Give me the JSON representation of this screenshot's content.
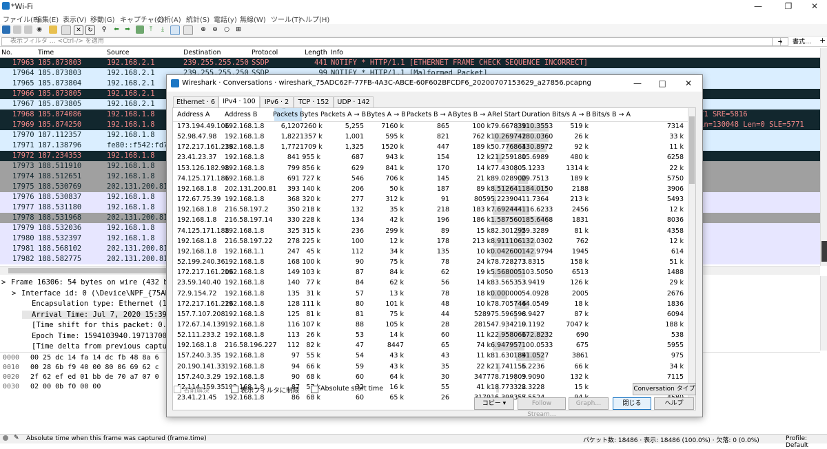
{
  "window": {
    "title": "*Wi-Fi"
  },
  "menu": [
    "ファイル(F)",
    "編集(E)",
    "表示(V)",
    "移動(G)",
    "キャプチャ(C)",
    "分析(A)",
    "統計(S)",
    "電話(y)",
    "無線(W)",
    "ツール(T)",
    "ヘルプ(H)"
  ],
  "filter": {
    "placeholder": "表示フィルタ … <Ctrl-/> を適用",
    "expr_label": "書式…",
    "add": "+"
  },
  "packet_list": {
    "columns": [
      "No.",
      "Time",
      "Source",
      "Destination",
      "Protocol",
      "Length",
      "Info"
    ],
    "rows": [
      {
        "no": "17963",
        "time": "185.873803",
        "src": "192.168.2.1",
        "dst": "239.255.255.250",
        "proto": "SSDP",
        "len": "441",
        "info": "NOTIFY * HTTP/1.1  [ETHERNET FRAME CHECK SEQUENCE INCORRECT]",
        "style": "dark"
      },
      {
        "no": "17964",
        "time": "185.873803",
        "src": "192.168.2.1",
        "dst": "239.255.255.250",
        "proto": "SSDP",
        "len": "99",
        "info": "NOTIFY * HTTP/1.1 [Malformed Packet]",
        "style": "light"
      },
      {
        "no": "17965",
        "time": "185.873804",
        "src": "192.168.2.1",
        "dst": "",
        "proto": "",
        "len": "",
        "info": "",
        "style": "light"
      },
      {
        "no": "17966",
        "time": "185.873805",
        "src": "192.168.2.1",
        "dst": "",
        "proto": "",
        "len": "",
        "info": "",
        "style": "dark"
      },
      {
        "no": "17967",
        "time": "185.873805",
        "src": "192.168.2.1",
        "dst": "",
        "proto": "",
        "len": "",
        "info": "",
        "style": "light"
      },
      {
        "no": "17968",
        "time": "185.874086",
        "src": "192.168.1.8",
        "dst": "",
        "proto": "",
        "len": "",
        "info": "71 SRE=5816",
        "style": "dark"
      },
      {
        "no": "17969",
        "time": "185.874250",
        "src": "192.168.1.8",
        "dst": "",
        "proto": "",
        "len": "",
        "info": "in=130048 Len=0 SLE=5771",
        "style": "dark"
      },
      {
        "no": "17970",
        "time": "187.112357",
        "src": "192.168.1.8",
        "dst": "",
        "proto": "",
        "len": "",
        "info": "",
        "style": "light"
      },
      {
        "no": "17971",
        "time": "187.138796",
        "src": "fe80::f542:fd7",
        "dst": "",
        "proto": "",
        "len": "",
        "info": "",
        "style": "light"
      },
      {
        "no": "17972",
        "time": "187.234353",
        "src": "192.168.1.8",
        "dst": "",
        "proto": "",
        "len": "",
        "info": "",
        "style": "dark"
      },
      {
        "no": "17973",
        "time": "188.511910",
        "src": "192.168.1.8",
        "dst": "",
        "proto": "",
        "len": "",
        "info": "",
        "style": "gray"
      },
      {
        "no": "17974",
        "time": "188.512651",
        "src": "192.168.1.8",
        "dst": "",
        "proto": "",
        "len": "",
        "info": "",
        "style": "gray"
      },
      {
        "no": "17975",
        "time": "188.530769",
        "src": "202.131.200.81",
        "dst": "",
        "proto": "",
        "len": "",
        "info": "",
        "style": "gray"
      },
      {
        "no": "17976",
        "time": "188.530837",
        "src": "192.168.1.8",
        "dst": "",
        "proto": "",
        "len": "",
        "info": "",
        "style": "lavender"
      },
      {
        "no": "17977",
        "time": "188.531180",
        "src": "192.168.1.8",
        "dst": "",
        "proto": "",
        "len": "",
        "info": "",
        "style": "lavender"
      },
      {
        "no": "17978",
        "time": "188.531968",
        "src": "202.131.200.81",
        "dst": "",
        "proto": "",
        "len": "",
        "info": "",
        "style": "gray"
      },
      {
        "no": "17979",
        "time": "188.532036",
        "src": "192.168.1.8",
        "dst": "",
        "proto": "",
        "len": "",
        "info": "",
        "style": "lavender"
      },
      {
        "no": "17980",
        "time": "188.532397",
        "src": "192.168.1.8",
        "dst": "",
        "proto": "",
        "len": "",
        "info": "",
        "style": "lavender"
      },
      {
        "no": "17981",
        "time": "188.568102",
        "src": "202.131.200.81",
        "dst": "",
        "proto": "",
        "len": "",
        "info": "",
        "style": "lavender"
      },
      {
        "no": "17982",
        "time": "188.582775",
        "src": "202.131.200.81",
        "dst": "",
        "proto": "",
        "len": "",
        "info": "",
        "style": "lavender"
      }
    ]
  },
  "details": [
    {
      "text": "Frame 16306: 54 bytes on wire (432 b",
      "indent": 0,
      "arrow": ">"
    },
    {
      "text": "Interface id: 0 (\\Device\\NPF_{75AD",
      "indent": 1,
      "arrow": ">"
    },
    {
      "text": "Encapsulation type: Ethernet (1)",
      "indent": 2,
      "arrow": ""
    },
    {
      "text": "Arrival Time: Jul  7, 2020 15:39:0",
      "indent": 2,
      "arrow": "",
      "selected": true
    },
    {
      "text": "[Time shift for this packet: 0.000",
      "indent": 2,
      "arrow": ""
    },
    {
      "text": "Epoch Time: 1594103940.197137000 s",
      "indent": 2,
      "arrow": ""
    },
    {
      "text": "[Time delta from previous captured",
      "indent": 2,
      "arrow": ""
    }
  ],
  "hex": [
    {
      "offset": "0000",
      "bytes": "00 25 dc 14 fa 14 dc fb  48 8a 6"
    },
    {
      "offset": "0010",
      "bytes": "00 28 6b f9 40 00 80 06  69 62 c"
    },
    {
      "offset": "0020",
      "bytes": "2f 62 ef ed 01 bb de 70  a7 07 0"
    },
    {
      "offset": "0030",
      "bytes": "02 00 0b f0 00 00"
    }
  ],
  "status": {
    "text": "Absolute time when this frame was captured (frame.time)",
    "packets": "パケット数: 18486 · 表示: 18486 (100.0%) · 欠落: 0 (0.0%)",
    "profile": "Profile: Default"
  },
  "dialog": {
    "title": "Wireshark · Conversations · wireshark_75ADC62F-77FB-4A3C-ABCE-60F602BFCDF6_20200707153629_a27856.pcapng",
    "tabs": [
      "Ethernet · 6",
      "IPv4 · 100",
      "IPv6 · 2",
      "TCP · 152",
      "UDP · 142"
    ],
    "active_tab": 1,
    "columns": [
      "Address A",
      "Address B",
      "Packets",
      "Bytes",
      "Packets A → B",
      "Bytes A → B",
      "Packets B → A",
      "Bytes B → A",
      "Rel Start",
      "Duration",
      "Bits/s A → B",
      "Bits/s B → A"
    ],
    "rows": [
      {
        "a": "173.194.49.106",
        "b": "192.168.1.8",
        "pk": "6,120",
        "by": "7260 k",
        "pab": "5,255",
        "bab": "7160 k",
        "pba": "865",
        "bba": "100 k",
        "rs": "79.667839",
        "du": "110.3553",
        "bsab": "519 k",
        "bsba": "7314",
        "rsf": 0.43,
        "duf": 0.6
      },
      {
        "a": "52.98.47.98",
        "b": "192.168.1.8",
        "pk": "1,822",
        "by": "1357 k",
        "pab": "1,001",
        "bab": "595 k",
        "pba": "821",
        "bba": "762 k",
        "rs": "10.269742",
        "du": "180.0360",
        "bsab": "26 k",
        "bsba": "33 k",
        "rsf": 0.06,
        "duf": 0.97
      },
      {
        "a": "172.217.161.238",
        "b": "192.168.1.8",
        "pk": "1,772",
        "by": "1709 k",
        "pab": "1,325",
        "bab": "1520 k",
        "pba": "447",
        "bba": "189 k",
        "rs": "50.776864",
        "du": "130.8972",
        "bsab": "92 k",
        "bsba": "11 k",
        "rsf": 0.27,
        "duf": 0.7
      },
      {
        "a": "23.41.23.37",
        "b": "192.168.1.8",
        "pk": "841",
        "by": "955 k",
        "pab": "687",
        "bab": "943 k",
        "pba": "154",
        "bba": "12 k",
        "rs": "21.259180",
        "du": "15.6989",
        "bsab": "480 k",
        "bsba": "6258",
        "rsf": 0.11,
        "duf": 0.09
      },
      {
        "a": "153.126.182.98",
        "b": "192.168.1.8",
        "pk": "799",
        "by": "856 k",
        "pab": "629",
        "bab": "841 k",
        "pba": "170",
        "bba": "14 k",
        "rs": "77.430805",
        "du": "5.1233",
        "bsab": "1314 k",
        "bsba": "22 k",
        "rsf": 0.42,
        "duf": 0.03
      },
      {
        "a": "74.125.171.186",
        "b": "192.168.1.8",
        "pk": "691",
        "by": "727 k",
        "pab": "546",
        "bab": "706 k",
        "pba": "145",
        "bba": "21 k",
        "rs": "89.028900",
        "du": "29.7513",
        "bsab": "189 k",
        "bsba": "5750",
        "rsf": 0.48,
        "duf": 0.16
      },
      {
        "a": "192.168.1.8",
        "b": "202.131.200.81",
        "pk": "393",
        "by": "140 k",
        "pab": "206",
        "bab": "50 k",
        "pba": "187",
        "bba": "89 k",
        "rs": "8.512641",
        "du": "184.0150",
        "bsab": "2188",
        "bsba": "3906",
        "rsf": 0.05,
        "duf": 0.99
      },
      {
        "a": "172.67.75.39",
        "b": "192.168.1.8",
        "pk": "368",
        "by": "320 k",
        "pab": "277",
        "bab": "312 k",
        "pba": "91",
        "bba": "8059",
        "rs": "5.223904",
        "du": "11.7364",
        "bsab": "213 k",
        "bsba": "5493",
        "rsf": 0.03,
        "duf": 0.06
      },
      {
        "a": "192.168.1.8",
        "b": "216.58.197.2",
        "pk": "350",
        "by": "218 k",
        "pab": "132",
        "bab": "35 k",
        "pba": "218",
        "bba": "183 k",
        "rs": "7.692444",
        "du": "116.6233",
        "bsab": "2456",
        "bsba": "12 k",
        "rsf": 0.04,
        "duf": 0.63
      },
      {
        "a": "192.168.1.8",
        "b": "216.58.197.14",
        "pk": "330",
        "by": "228 k",
        "pab": "134",
        "bab": "42 k",
        "pba": "196",
        "bba": "186 k",
        "rs": "1.587560",
        "du": "185.6468",
        "bsab": "1831",
        "bsba": "8036",
        "rsf": 0.01,
        "duf": 1.0
      },
      {
        "a": "74.125.171.188",
        "b": "192.168.1.8",
        "pk": "325",
        "by": "315 k",
        "pab": "236",
        "bab": "299 k",
        "pba": "89",
        "bba": "15 k",
        "rs": "82.301295",
        "du": "29.3289",
        "bsab": "81 k",
        "bsba": "4358",
        "rsf": 0.44,
        "duf": 0.16
      },
      {
        "a": "192.168.1.8",
        "b": "216.58.197.22",
        "pk": "278",
        "by": "225 k",
        "pab": "100",
        "bab": "12 k",
        "pba": "178",
        "bba": "213 k",
        "rs": "8.911106",
        "du": "132.0302",
        "bsab": "762",
        "bsba": "12 k",
        "rsf": 0.05,
        "duf": 0.71
      },
      {
        "a": "192.168.1.8",
        "b": "192.168.1.1",
        "pk": "247",
        "by": "45 k",
        "pab": "112",
        "bab": "34 k",
        "pba": "135",
        "bba": "10 k",
        "rs": "0.042600",
        "du": "142.9794",
        "bsab": "1945",
        "bsba": "614",
        "rsf": 0.0,
        "duf": 0.77
      },
      {
        "a": "52.199.240.36",
        "b": "192.168.1.8",
        "pk": "168",
        "by": "100 k",
        "pab": "90",
        "bab": "75 k",
        "pba": "78",
        "bba": "24 k",
        "rs": "78.728273",
        "du": "3.8315",
        "bsab": "158 k",
        "bsba": "51 k",
        "rsf": 0.42,
        "duf": 0.02
      },
      {
        "a": "172.217.161.206",
        "b": "192.168.1.8",
        "pk": "149",
        "by": "103 k",
        "pab": "87",
        "bab": "84 k",
        "pba": "62",
        "bba": "19 k",
        "rs": "5.568005",
        "du": "103.5050",
        "bsab": "6513",
        "bsba": "1488",
        "rsf": 0.03,
        "duf": 0.56
      },
      {
        "a": "23.59.140.40",
        "b": "192.168.1.8",
        "pk": "140",
        "by": "77 k",
        "pab": "84",
        "bab": "62 k",
        "pba": "56",
        "bba": "14 k",
        "rs": "83.565353",
        "du": "3.9419",
        "bsab": "126 k",
        "bsba": "29 k",
        "rsf": 0.45,
        "duf": 0.02
      },
      {
        "a": "72.9.154.72",
        "b": "192.168.1.8",
        "pk": "135",
        "by": "31 k",
        "pab": "57",
        "bab": "13 k",
        "pba": "78",
        "bba": "18 k",
        "rs": "0.000000",
        "du": "54.0928",
        "bsab": "2005",
        "bsba": "2676",
        "rsf": 0.0,
        "duf": 0.29
      },
      {
        "a": "172.217.161.226",
        "b": "192.168.1.8",
        "pk": "128",
        "by": "111 k",
        "pab": "80",
        "bab": "101 k",
        "pba": "48",
        "bba": "10 k",
        "rs": "78.705746",
        "du": "44.0549",
        "bsab": "18 k",
        "bsba": "1836",
        "rsf": 0.42,
        "duf": 0.24
      },
      {
        "a": "157.7.107.208",
        "b": "192.168.1.8",
        "pk": "125",
        "by": "81 k",
        "pab": "81",
        "bab": "75 k",
        "pba": "44",
        "bba": "5289",
        "rs": "75.596598",
        "du": "6.9427",
        "bsab": "87 k",
        "bsba": "6094",
        "rsf": 0.41,
        "duf": 0.04
      },
      {
        "a": "172.67.14.139",
        "b": "192.168.1.8",
        "pk": "116",
        "by": "107 k",
        "pab": "88",
        "bab": "105 k",
        "pba": "28",
        "bba": "2815",
        "rs": "47.934219",
        "du": "0.1192",
        "bsab": "7047 k",
        "bsba": "188 k",
        "rsf": 0.26,
        "duf": 0.0
      },
      {
        "a": "52.111.233.2",
        "b": "192.168.1.8",
        "pk": "113",
        "by": "26 k",
        "pab": "53",
        "bab": "14 k",
        "pba": "60",
        "bba": "11 k",
        "rs": "22.958066",
        "du": "172.8232",
        "bsab": "690",
        "bsba": "538",
        "rsf": 0.12,
        "duf": 0.93
      },
      {
        "a": "192.168.1.8",
        "b": "216.58.196.227",
        "pk": "112",
        "by": "82 k",
        "pab": "47",
        "bab": "8447",
        "pba": "65",
        "bba": "74 k",
        "rs": "6.947957",
        "du": "100.0533",
        "bsab": "675",
        "bsba": "5955",
        "rsf": 0.04,
        "duf": 0.54
      },
      {
        "a": "157.240.3.35",
        "b": "192.168.1.8",
        "pk": "97",
        "by": "55 k",
        "pab": "54",
        "bab": "43 k",
        "pba": "43",
        "bba": "11 k",
        "rs": "81.630184",
        "du": "91.0527",
        "bsab": "3861",
        "bsba": "975",
        "rsf": 0.44,
        "duf": 0.49
      },
      {
        "a": "20.190.141.33",
        "b": "192.168.1.8",
        "pk": "94",
        "by": "66 k",
        "pab": "59",
        "bab": "43 k",
        "pba": "35",
        "bba": "22 k",
        "rs": "21.741156",
        "du": "5.2236",
        "bsab": "66 k",
        "bsba": "34 k",
        "rsf": 0.12,
        "duf": 0.03
      },
      {
        "a": "157.240.3.29",
        "b": "192.168.1.8",
        "pk": "90",
        "by": "68 k",
        "pab": "60",
        "bab": "64 k",
        "pba": "30",
        "bba": "3477",
        "rs": "78.719809",
        "du": "3.9090",
        "bsab": "132 k",
        "bsba": "7115",
        "rsf": 0.42,
        "duf": 0.02
      },
      {
        "a": "52.114.159.35",
        "b": "192.168.1.8",
        "pk": "87",
        "by": "57 k",
        "pab": "32",
        "bab": "16 k",
        "pba": "55",
        "bba": "41 k",
        "rs": "18.773322",
        "du": "8.3228",
        "bsab": "15 k",
        "bsba": "39 k",
        "rsf": 0.1,
        "duf": 0.04
      },
      {
        "a": "23.41.21.45",
        "b": "192.168.1.8",
        "pk": "86",
        "by": "68 k",
        "pab": "60",
        "bab": "65 k",
        "pba": "26",
        "bba": "3179",
        "rs": "16.398357",
        "du": "5.5524",
        "bsab": "94 k",
        "bsba": "4580",
        "rsf": 0.09,
        "duf": 0.03
      }
    ],
    "options": {
      "name_resolution": "名前解決",
      "limit_filter": "表示フィルタに制限",
      "absolute_time": "Absolute start time",
      "conv_type": "Conversation タイプ"
    },
    "buttons": {
      "copy": "コピー",
      "follow": "Follow Stream…",
      "graph": "Graph…",
      "close": "閉じる",
      "help": "ヘルプ"
    },
    "colors": {
      "selected_col_header": "#cce4f7",
      "dark_row": "#12272e",
      "dark_text": "#f78b8b",
      "light_row": "#daeeff",
      "gray_row": "#a0a0a0",
      "lavender_row": "#e7e6ff"
    }
  }
}
